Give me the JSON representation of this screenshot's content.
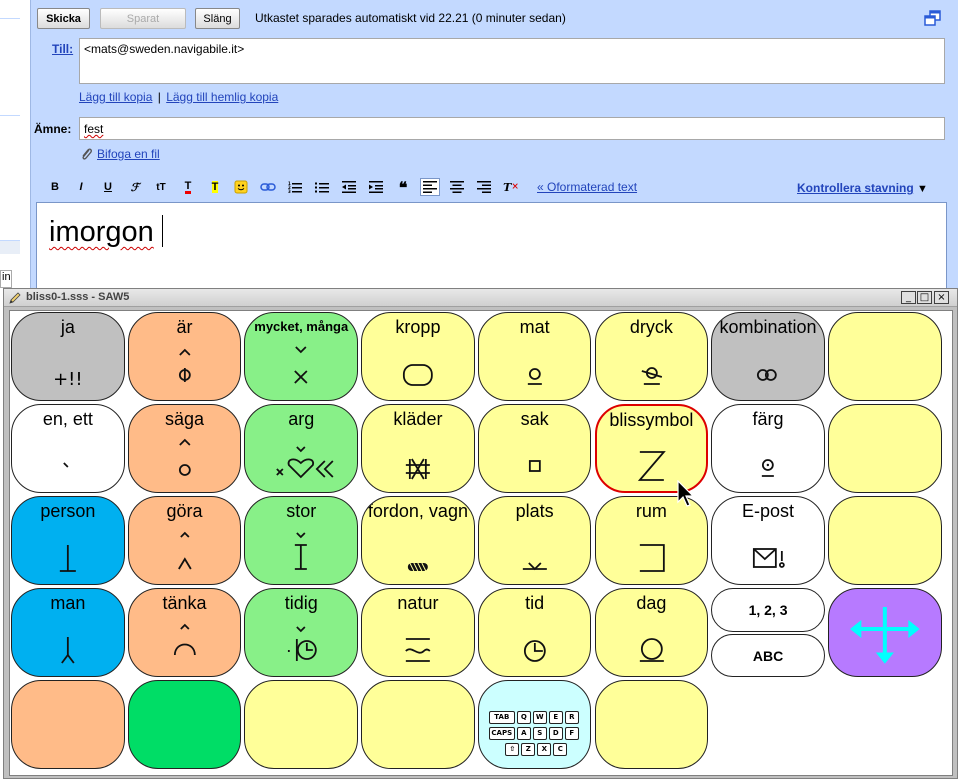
{
  "toolbar": {
    "send_label": "Skicka",
    "saved_label": "Sparat",
    "discard_label": "Släng",
    "autosave_text": "Utkastet sparades automatiskt vid 22.21 (0 minuter sedan)"
  },
  "to": {
    "label": "Till:",
    "value": "<mats@sweden.navigabile.it>"
  },
  "cc_link": "Lägg till kopia",
  "separator": "|",
  "bcc_link": "Lägg till hemlig kopia",
  "subject": {
    "label": "Ämne:",
    "value": "fest"
  },
  "attach_label": "Bifoga en fil",
  "format": {
    "bold": "B",
    "italic": "I",
    "underline": "U",
    "plain_text_link": "« Oformaterad text",
    "spellcheck": "Kontrollera stavning",
    "spellcheck_arrow": "▼"
  },
  "editor": {
    "text": "imorgon"
  },
  "left_sliver": {
    "input_text": "in"
  },
  "saw": {
    "title": "bliss0-1.sss - SAW5",
    "min": "_",
    "max": "□",
    "close": "×"
  },
  "grid": {
    "colors": {
      "gray": "#c0c0c0",
      "orange": "#ffbb88",
      "green": "#88f088",
      "yellow": "#ffff99",
      "white": "#ffffff",
      "blue": "#00b0f0",
      "purple": "#b77aff",
      "darkgreen": "#00dd66",
      "cyan": "#ccffff"
    },
    "cells": [
      {
        "label": "ja",
        "color": "gray",
        "symbol": "+!!"
      },
      {
        "label": "är",
        "color": "orange",
        "symbol": "are"
      },
      {
        "label": "mycket, många",
        "color": "green",
        "symbol": "many",
        "small": true
      },
      {
        "label": "kropp",
        "color": "yellow",
        "symbol": "body"
      },
      {
        "label": "mat",
        "color": "yellow",
        "symbol": "food"
      },
      {
        "label": "dryck",
        "color": "yellow",
        "symbol": "drink"
      },
      {
        "label": "kombination",
        "color": "gray",
        "symbol": "combo"
      },
      {
        "label": "",
        "color": "yellow",
        "symbol": ""
      },
      {
        "label": "en, ett",
        "color": "white",
        "symbol": "one"
      },
      {
        "label": "säga",
        "color": "orange",
        "symbol": "say"
      },
      {
        "label": "arg",
        "color": "green",
        "symbol": "angry"
      },
      {
        "label": "kläder",
        "color": "yellow",
        "symbol": "clothes"
      },
      {
        "label": "sak",
        "color": "yellow",
        "symbol": "thing"
      },
      {
        "label": "blissymbol",
        "color": "yellow",
        "symbol": "bliss",
        "selected": true
      },
      {
        "label": "färg",
        "color": "white",
        "symbol": "color"
      },
      {
        "label": "",
        "color": "yellow",
        "symbol": ""
      },
      {
        "label": "person",
        "color": "blue",
        "symbol": "person"
      },
      {
        "label": "göra",
        "color": "orange",
        "symbol": "do"
      },
      {
        "label": "stor",
        "color": "green",
        "symbol": "big"
      },
      {
        "label": "fordon, vagn",
        "color": "yellow",
        "symbol": "vehicle"
      },
      {
        "label": "plats",
        "color": "yellow",
        "symbol": "place"
      },
      {
        "label": "rum",
        "color": "yellow",
        "symbol": "room"
      },
      {
        "label": "E-post",
        "color": "white",
        "symbol": "email"
      },
      {
        "label": "",
        "color": "yellow",
        "symbol": ""
      },
      {
        "label": "man",
        "color": "blue",
        "symbol": "man"
      },
      {
        "label": "tänka",
        "color": "orange",
        "symbol": "think"
      },
      {
        "label": "tidig",
        "color": "green",
        "symbol": "early"
      },
      {
        "label": "natur",
        "color": "yellow",
        "symbol": "nature"
      },
      {
        "label": "tid",
        "color": "yellow",
        "symbol": "time"
      },
      {
        "label": "dag",
        "color": "yellow",
        "symbol": "day"
      },
      {
        "label": "",
        "color": "yellow",
        "symbol": ""
      },
      {
        "label": "",
        "color": "purple",
        "symbol": "arrows"
      },
      {
        "label": "",
        "color": "orange",
        "symbol": ""
      },
      {
        "label": "",
        "color": "darkgreen",
        "symbol": ""
      },
      {
        "label": "",
        "color": "yellow",
        "symbol": ""
      },
      {
        "label": "",
        "color": "yellow",
        "symbol": ""
      },
      {
        "label": "",
        "color": "yellow",
        "symbol": ""
      },
      {
        "label": "",
        "color": "yellow",
        "symbol": ""
      }
    ],
    "numbers_label": "1, 2, 3",
    "abc_label": "ABC",
    "keyboard": {
      "row1": [
        "TAB",
        "Q",
        "W",
        "E",
        "R"
      ],
      "row2": [
        "CAPS",
        "A",
        "S",
        "D",
        "F"
      ],
      "row3": [
        "⇧",
        "Z",
        "X",
        "C"
      ]
    }
  }
}
